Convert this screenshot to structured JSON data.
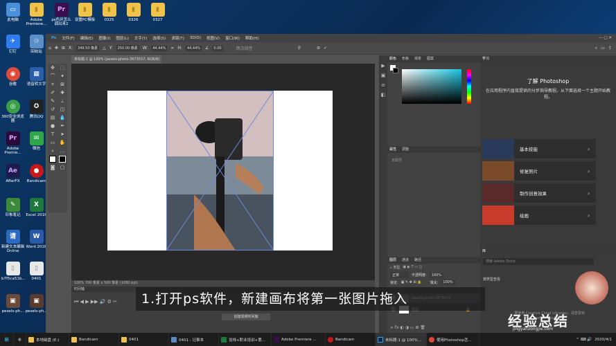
{
  "desktop_icons": [
    {
      "label": "此电脑",
      "color": "#4a90d9",
      "glyph": "▭"
    },
    {
      "label": "Adobe Premiere...",
      "color": "#f0c24a",
      "glyph": "▮"
    },
    {
      "label": "ps色环怎么调出来2",
      "color": "#3a0e4d",
      "glyph": "Pr"
    },
    {
      "label": "设置PC模板",
      "color": "#f0c24a",
      "glyph": "▮"
    },
    {
      "label": "0325",
      "color": "#f0c24a",
      "glyph": "▮"
    },
    {
      "label": "0326",
      "color": "#f0c24a",
      "glyph": "▮"
    },
    {
      "label": "0327",
      "color": "#f0c24a",
      "glyph": "▮"
    },
    {
      "label": "钉钉",
      "color": "#2f7cf0",
      "glyph": "✈"
    },
    {
      "label": "回收站",
      "color": "#5b8fc9",
      "glyph": "♲"
    },
    {
      "label": "谷歌",
      "color": "#e04a3a",
      "glyph": "◉"
    },
    {
      "label": "语音转文字",
      "color": "#2b5ea8",
      "glyph": "▦"
    },
    {
      "label": "360安全浏览器",
      "color": "#3aa04a",
      "glyph": "◎"
    },
    {
      "label": "腾讯QQ",
      "color": "#222222",
      "glyph": "✪"
    },
    {
      "label": "Adobe Premie...",
      "color": "#2a0a3a",
      "glyph": "Pr"
    },
    {
      "label": "微信",
      "color": "#2fa84a",
      "glyph": "✉"
    },
    {
      "label": "AfterFX",
      "color": "#1c1c4c",
      "glyph": "Ae"
    },
    {
      "label": "Bandicam",
      "color": "#c81818",
      "glyph": "●"
    },
    {
      "label": "印象笔记",
      "color": "#3a8a3a",
      "glyph": "✎"
    },
    {
      "label": "Excel 2016",
      "color": "#1d7a3c",
      "glyph": "X"
    },
    {
      "label": "新建文本编辑Online",
      "color": "#2a6ac0",
      "glyph": "请"
    },
    {
      "label": "Word 2016",
      "color": "#2a5aa8",
      "glyph": "W"
    },
    {
      "label": "b7f5ca51b...",
      "color": "#e8e8e8",
      "glyph": "▯"
    },
    {
      "label": "0401",
      "color": "#e8e8e8",
      "glyph": "▯"
    },
    {
      "label": "pexels-ph...",
      "color": "#6a4a3a",
      "glyph": "▣"
    },
    {
      "label": "pexels-ph...",
      "color": "#5a3a2a",
      "glyph": "▣"
    }
  ],
  "menubar": [
    "文件(F)",
    "编辑(E)",
    "图像(I)",
    "图层(L)",
    "文字(Y)",
    "选择(S)",
    "滤镜(T)",
    "3D(D)",
    "视图(V)",
    "窗口(W)",
    "帮助(H)"
  ],
  "options": {
    "x_label": "X:",
    "x_value": "349.50 像素",
    "y_label": "Y:",
    "y_value": "250.00 像素",
    "w_label": "W:",
    "w_value": "44.44%",
    "h_label": "H:",
    "h_value": "44.44%",
    "angle": "0.00",
    "interp": "两次线性"
  },
  "doc_tab": "未标题-1 @ 100% (pexels-photo-3673557, RGB/8)",
  "status": "100%    700 像素 x 500 像素 (1080 ppi)",
  "timeline": {
    "header": "时间轴",
    "create_button": "创建视频时间轴"
  },
  "caption": "1.打开ps软件，新建画布将第一张图片拖入",
  "color_panel": {
    "tabs": [
      "颜色",
      "色板",
      "渐变",
      "图案"
    ],
    "swatch_hex": "#19c6e2"
  },
  "properties_panel": {
    "tabs": [
      "属性",
      "调整"
    ],
    "note": "无属性"
  },
  "layers_panel": {
    "tabs": [
      "图层",
      "通道",
      "路径"
    ],
    "blend": "正常",
    "opacity_label": "不透明度:",
    "opacity": "100%",
    "lock_label": "锁定:",
    "fill_label": "填充:",
    "fill": "100%",
    "layers": [
      {
        "name": "pexels-photo-3673557"
      },
      {
        "name": "背景"
      }
    ]
  },
  "learn_panel": {
    "tab": "学习",
    "title": "了解 Photoshop",
    "subtitle": "在应用程序内直接提供的分步指导教程。从下面选择一个主题开始教程。",
    "cards": [
      {
        "label": "基本技能",
        "color": "#2a3a5a"
      },
      {
        "label": "修复照片",
        "color": "#7a4a2a"
      },
      {
        "label": "制作创意效果",
        "color": "#5a2a2a"
      },
      {
        "label": "绘画",
        "color": "#c83a2a"
      }
    ],
    "libraries_tab": "库",
    "search_placeholder": "搜索 Adobe Stock",
    "lib_type": "按类型查看",
    "lib_note": "要使用 Creative Cloud Libraries，请登录到 Creative Cloud 帐户。"
  },
  "taskbar": [
    {
      "label": "本地磁盘 (E:)",
      "color": "#f0c24a"
    },
    {
      "label": "Bandicam",
      "color": "#f0c24a"
    },
    {
      "label": "0401",
      "color": "#f0c24a"
    },
    {
      "label": "0401 - 记事本",
      "color": "#5a8ac8"
    },
    {
      "label": "设线+职业培训+第...",
      "color": "#1d7a3c"
    },
    {
      "label": "Adobe Premiere ...",
      "color": "#3a0e4d"
    },
    {
      "label": "Bandicam",
      "color": "#c81818"
    },
    {
      "label": "未标题-1 @ 100%...",
      "color": "#0a2a4a"
    },
    {
      "label": "使用Photoshop怎...",
      "color": "#e04a3a"
    }
  ],
  "clock": "2020/4/1",
  "watermark": "经验总结",
  "watermark_url": "jingyanzongjie.com"
}
